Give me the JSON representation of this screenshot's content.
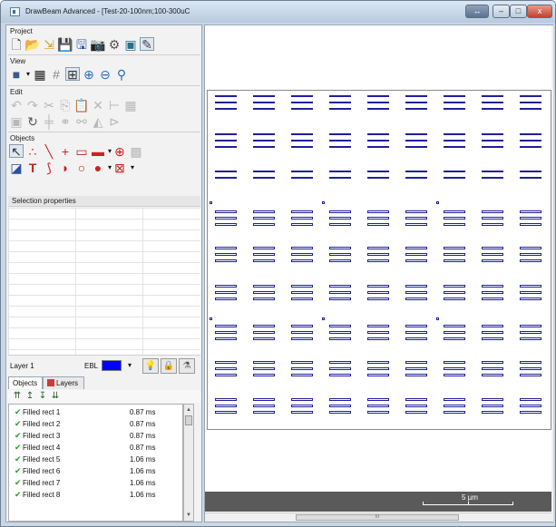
{
  "window": {
    "title": "DrawBeam Advanced - [Test-20-100nm;100-300uC",
    "buttons": {
      "extra": "↔",
      "minimize": "–",
      "maximize": "□",
      "close": "x"
    }
  },
  "left_panel": {
    "sections": {
      "project": "Project",
      "view": "View",
      "edit": "Edit",
      "objects": "Objects"
    },
    "selection_properties": "Selection properties",
    "layer": {
      "name": "Layer 1",
      "ebl_label": "EBL",
      "ebl_color": "#0000ff"
    },
    "tabs": {
      "objects": "Objects",
      "layers": "Layers"
    },
    "objects": [
      {
        "name": "Filled rect 1",
        "time": "0.87 ms"
      },
      {
        "name": "Filled rect 2",
        "time": "0.87 ms"
      },
      {
        "name": "Filled rect 3",
        "time": "0.87 ms"
      },
      {
        "name": "Filled rect 4",
        "time": "0.87 ms"
      },
      {
        "name": "Filled rect 5",
        "time": "1.06 ms"
      },
      {
        "name": "Filled rect 6",
        "time": "1.06 ms"
      },
      {
        "name": "Filled rect 7",
        "time": "1.06 ms"
      },
      {
        "name": "Filled rect 8",
        "time": "1.06 ms"
      }
    ]
  },
  "canvas": {
    "scale_label": "5 µm",
    "scroll_mark": "III",
    "pattern_color": "#1f1f9a"
  }
}
